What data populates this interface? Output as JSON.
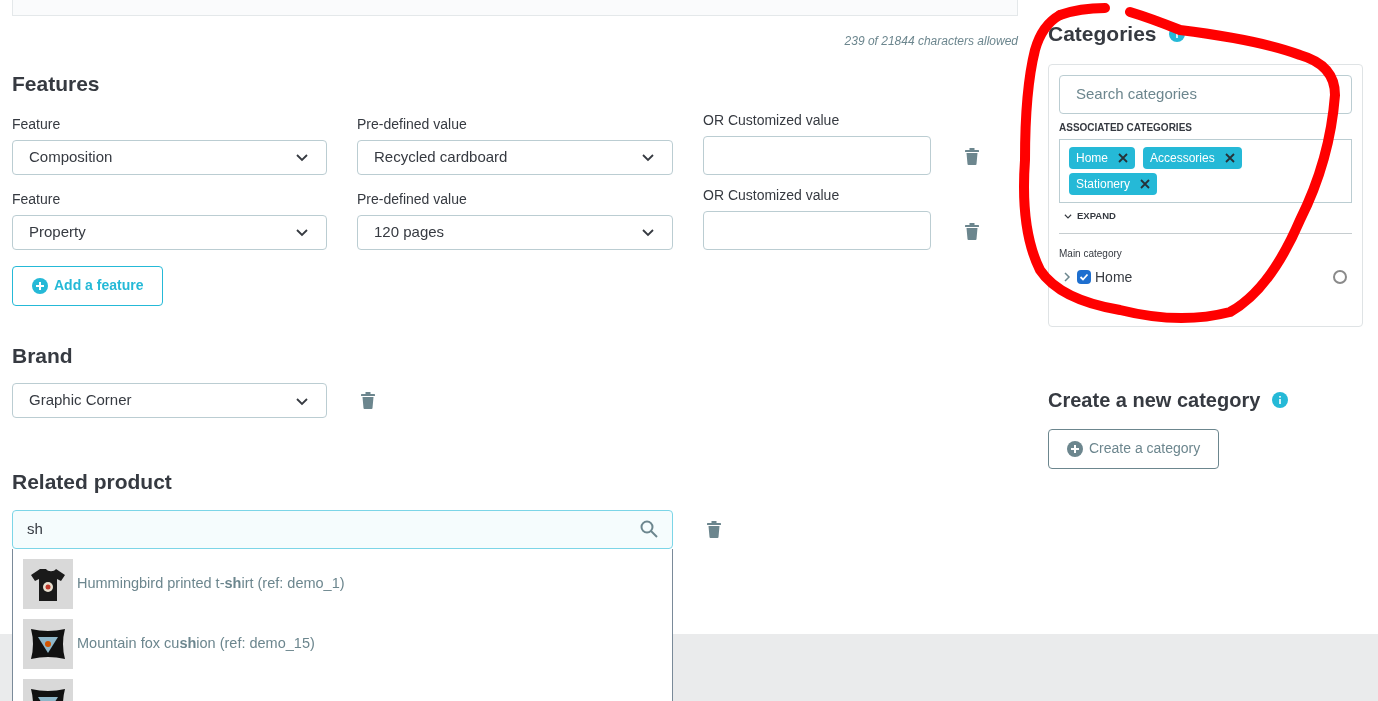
{
  "description_counter": "239 of 21844 characters allowed",
  "features": {
    "title": "Features",
    "rows": [
      {
        "feature_label": "Feature",
        "feature": "Composition",
        "predefined_label": "Pre-defined value",
        "predefined": "Recycled cardboard",
        "custom_label": "OR Customized value"
      },
      {
        "feature_label": "Feature",
        "feature": "Property",
        "predefined_label": "Pre-defined value",
        "predefined": "120 pages",
        "custom_label": "OR Customized value"
      }
    ],
    "add_button": "Add a feature"
  },
  "brand": {
    "title": "Brand",
    "value": "Graphic Corner"
  },
  "related_product": {
    "title": "Related product",
    "value": "sh",
    "results": [
      {
        "name": "Hummingbird printed t-**sh**irt (ref: demo_1)",
        "kind": "shirt"
      },
      {
        "name": "Mountain fox cu**sh**ion (ref: demo_15)",
        "kind": "cushion"
      },
      {
        "kind": "cushion"
      }
    ]
  },
  "categories": {
    "title": "Categories",
    "search_placeholder": "Search categories",
    "associated_label": "ASSOCIATED CATEGORIES",
    "tags": [
      "Home",
      "Accessories",
      "Stationery"
    ],
    "expand": "EXPAND",
    "main_category_label": "Main category",
    "tree": [
      {
        "label": "Home",
        "checked": true,
        "selected": false
      }
    ]
  },
  "create_category": {
    "title": "Create a new category",
    "button": "Create a category"
  }
}
